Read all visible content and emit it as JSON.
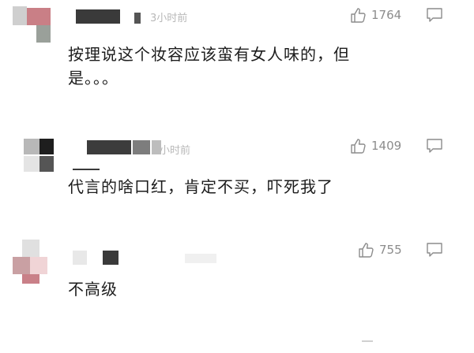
{
  "comments": [
    {
      "time": "3小时前",
      "likes": "1764",
      "text": "按理说这个妆容应该蛮有女人味的，但是。。。"
    },
    {
      "time": "小时前",
      "likes": "1409",
      "text": "代言的啥口红，肯定不买，吓死我了"
    },
    {
      "time": "",
      "likes": "755",
      "text": "不高级"
    }
  ],
  "icons": {
    "like": "thumbs-up-icon",
    "reply": "comment-bubble-icon"
  },
  "colors": {
    "text": "#1c1c1c",
    "meta": "#8c8c8c",
    "time": "#b8b8b8"
  }
}
